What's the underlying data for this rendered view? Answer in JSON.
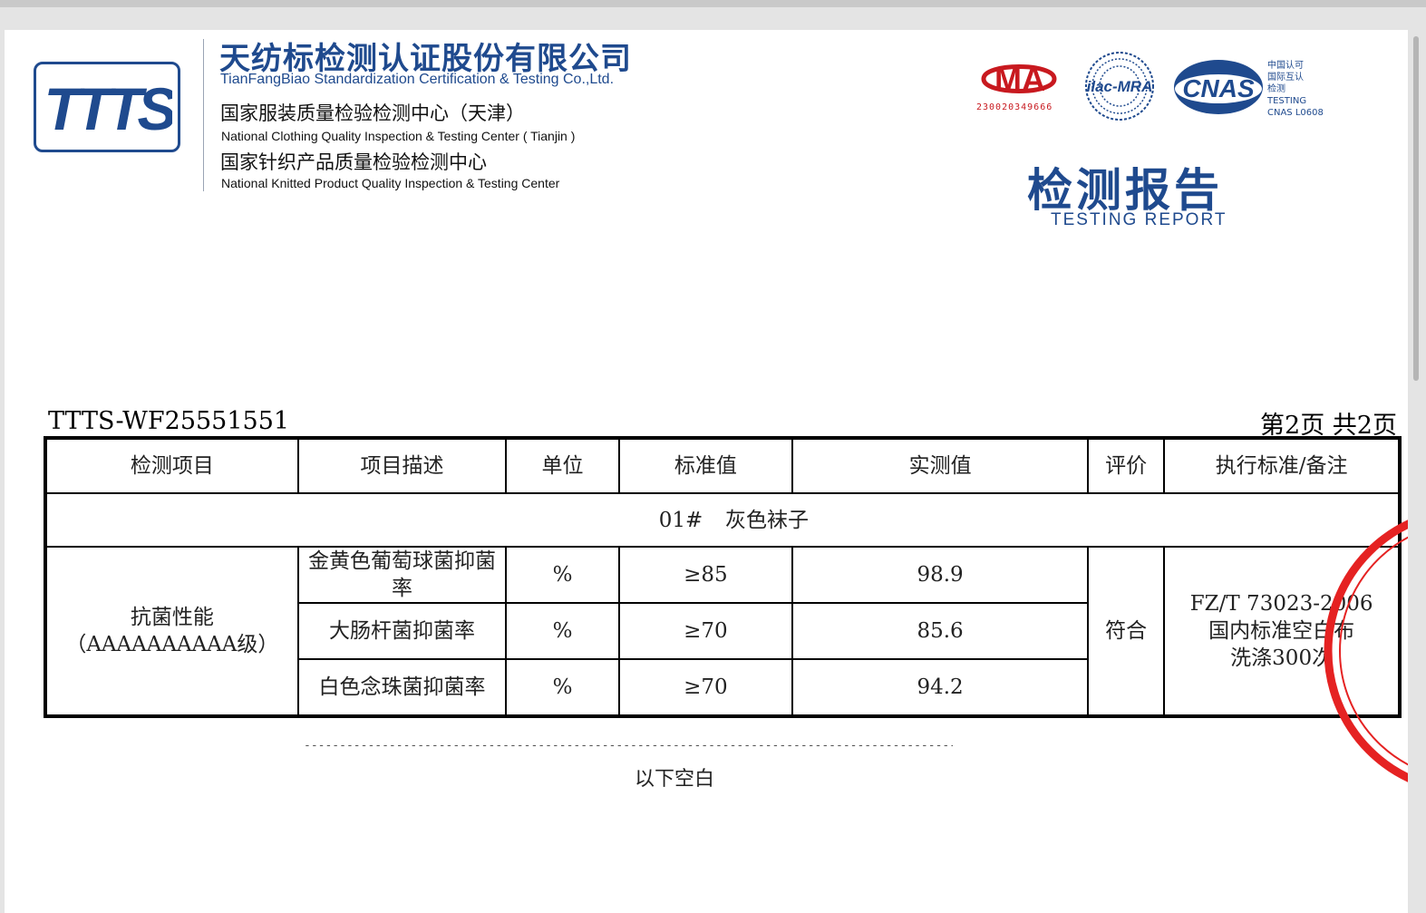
{
  "header": {
    "logo_text": "TTTS",
    "company_cn": "天纺标检测认证股份有限公司",
    "company_en": "TianFangBiao Standardization Certification & Testing Co.,Ltd.",
    "center1_cn": "国家服装质量检验检测中心（天津）",
    "center1_en": "National Clothing Quality Inspection & Testing Center ( Tianjin )",
    "center2_cn": "国家针织产品质量检验检测中心",
    "center2_en": "National Knitted Product Quality Inspection & Testing Center"
  },
  "accreditation": {
    "cma_text": "MA",
    "cma_number": "230020349666",
    "ilac_text": "ilac-MRA",
    "cnas_text": "CNAS",
    "cnas_side": [
      "中国认可",
      "国际互认",
      "检测",
      "TESTING",
      "CNAS L0608"
    ]
  },
  "report": {
    "title_cn": "检测报告",
    "title_en": "TESTING  REPORT",
    "number": "TTTS-WF25551551",
    "page_indicator": "第2页  共2页"
  },
  "table": {
    "headers": [
      "检测项目",
      "项目描述",
      "单位",
      "标准值",
      "实测值",
      "评价",
      "执行标准/备注"
    ],
    "sample": {
      "no": "01#",
      "name": "灰色袜子"
    },
    "category_line1": "抗菌性能",
    "category_line2": "（AAAAAAAAAA级）",
    "rows": [
      {
        "desc": "金黄色葡萄球菌抑菌率",
        "unit": "%",
        "standard": "≥85",
        "measured": "98.9"
      },
      {
        "desc": "大肠杆菌抑菌率",
        "unit": "%",
        "standard": "≥70",
        "measured": "85.6"
      },
      {
        "desc": "白色念珠菌抑菌率",
        "unit": "%",
        "standard": "≥70",
        "measured": "94.2"
      }
    ],
    "evaluation": "符合",
    "remark_line1": "FZ/T 73023-2006",
    "remark_line2": "国内标准空白布",
    "remark_line3": "洗涤300次"
  },
  "footer": {
    "blank_note": "以下空白"
  },
  "colors": {
    "brand_blue": "#1f4a8e",
    "cma_red": "#c8191f",
    "seal_red": "#e52222"
  }
}
